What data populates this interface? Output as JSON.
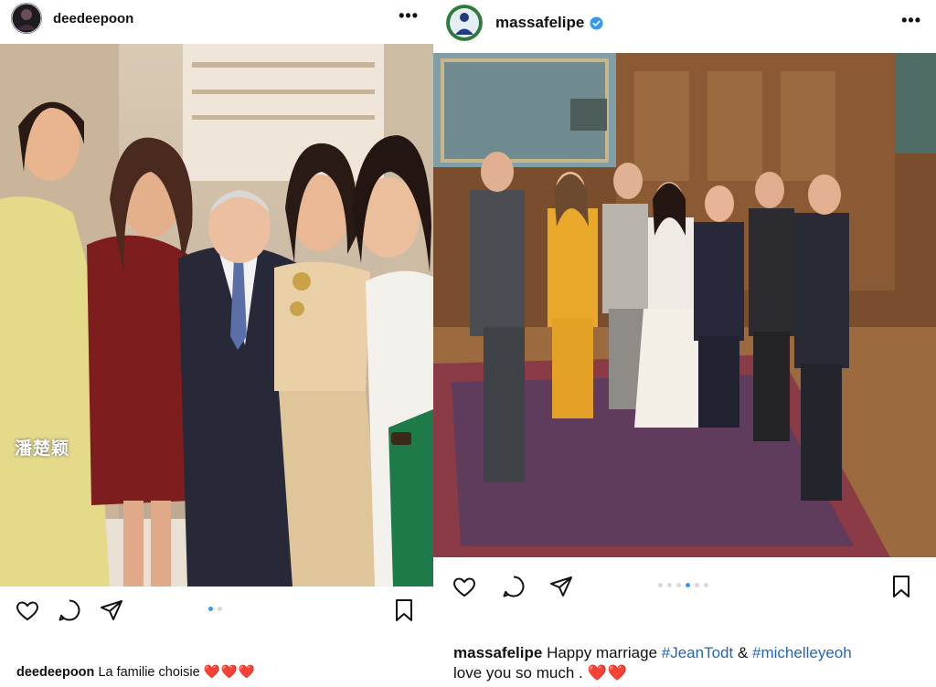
{
  "posts": [
    {
      "username": "deedeepoon",
      "more_label": "•••",
      "watermark": "潘楚颖",
      "carousel": {
        "count": 2,
        "active_index": 0
      },
      "caption": {
        "user": "deedeepoon",
        "text": "La familie choisie",
        "hearts": "❤️❤️❤️"
      }
    },
    {
      "username": "massafelipe",
      "verified": true,
      "more_label": "•••",
      "carousel": {
        "count": 6,
        "active_index": 3
      },
      "caption": {
        "user": "massafelipe",
        "text_before": "Happy marriage",
        "tag1": "#JeanTodt",
        "amp": "&",
        "tag2": "#michelleyeoh",
        "text_after": "love you so much .",
        "hearts": "❤️❤️"
      }
    }
  ],
  "icons": {
    "like": "heart-icon",
    "comment": "comment-icon",
    "share": "share-icon",
    "save": "bookmark-icon",
    "verified": "verified-badge-icon"
  },
  "colors": {
    "link_blue": "#2466b6",
    "carousel_active": "#3897f0",
    "verified_blue": "#3897f0",
    "heart_red": "#e0242f"
  }
}
